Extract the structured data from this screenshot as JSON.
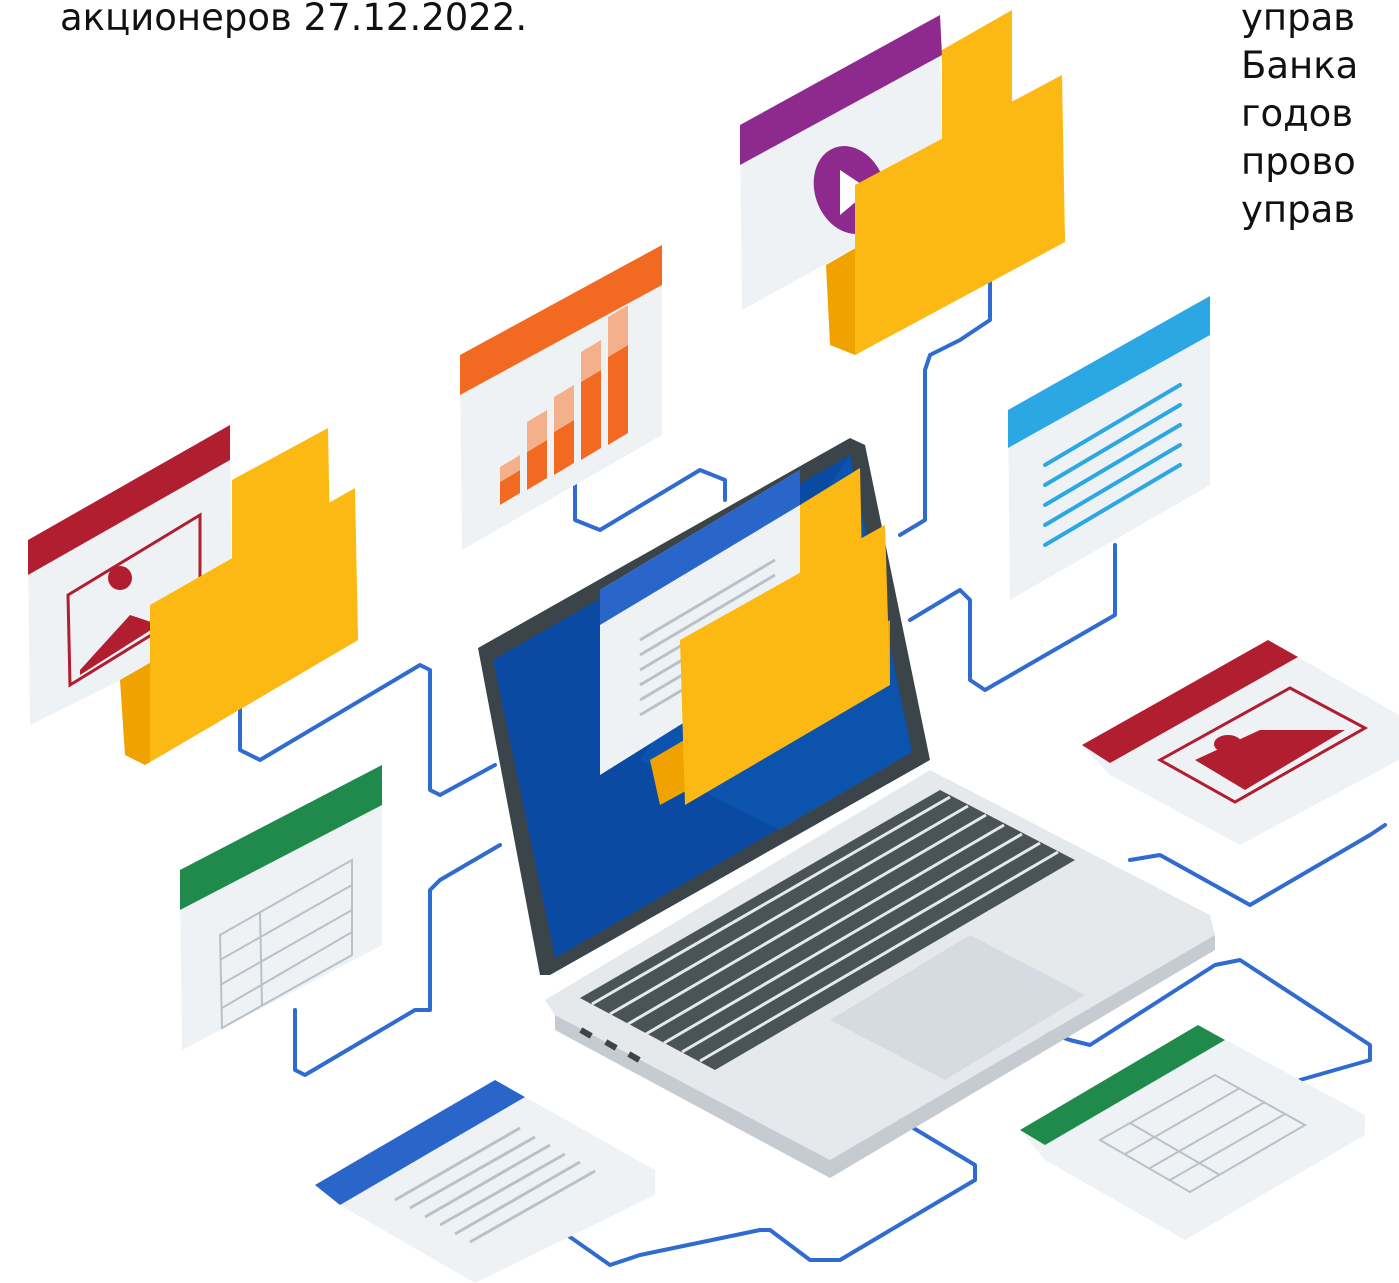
{
  "text": {
    "left_lines": [
      "акционеров 27.12.2022."
    ],
    "right_lines": [
      "управ",
      "Банка",
      "годов",
      "прово",
      "управ"
    ]
  },
  "colors": {
    "line": "#2f6bd0",
    "folder": "#fdb913",
    "folder_dark": "#f0a300",
    "red": "#b01e2f",
    "orange": "#f26a21",
    "purple": "#8e2a8e",
    "blue": "#2a66c9",
    "sky": "#2ba7e3",
    "green": "#1f8a4c",
    "screen": "#0b4aa2",
    "laptop_body": "#e6e9ec",
    "keys": "#4a5358"
  },
  "icons": [
    "image-window-icon",
    "folder-icon",
    "bar-chart-window-icon",
    "video-window-icon",
    "text-lines-window-icon",
    "table-window-icon",
    "document-window-icon",
    "laptop-icon"
  ]
}
